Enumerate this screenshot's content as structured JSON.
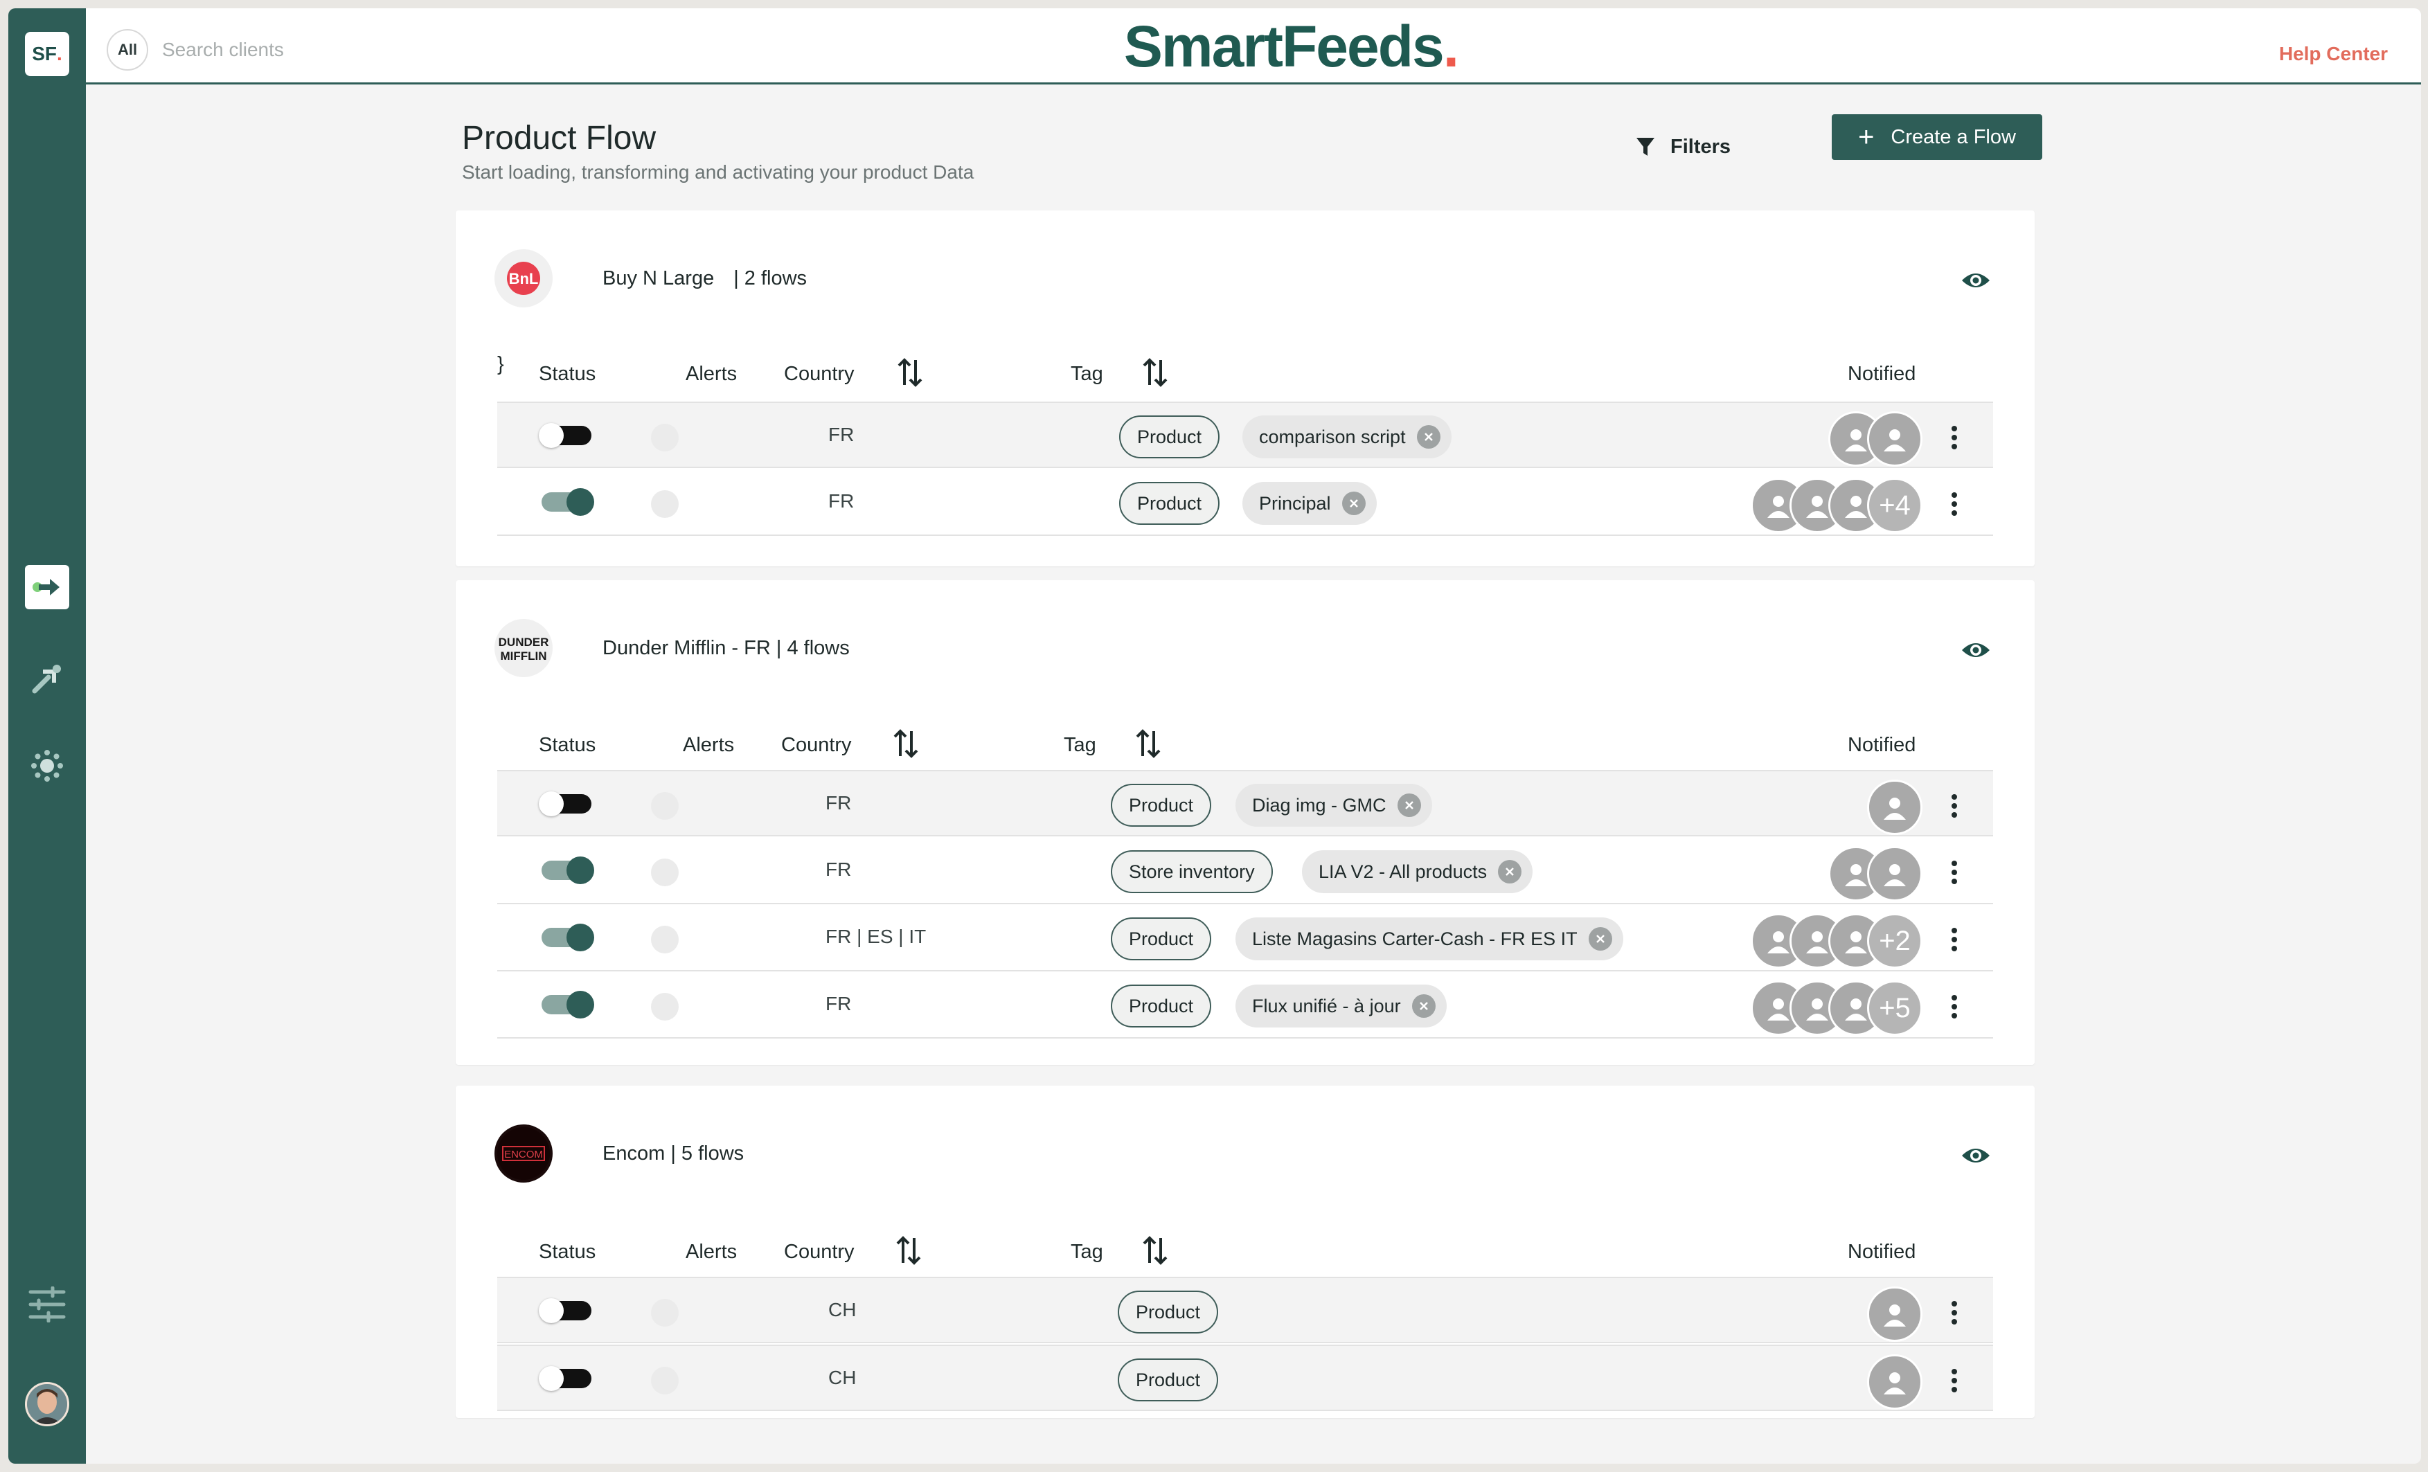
{
  "brand": {
    "name": "SmartFeeds",
    "dot": ".",
    "sidebar_logo": "SF",
    "sidebar_logo_dot": "."
  },
  "topbar": {
    "all_label": "All",
    "search_placeholder": "Search clients",
    "help_label": "Help Center"
  },
  "page": {
    "title": "Product Flow",
    "subtitle": "Start loading, transforming and activating your product Data"
  },
  "actions": {
    "filters_label": "Filters",
    "create_label": "Create a Flow"
  },
  "columns": {
    "status": "Status",
    "alerts": "Alerts",
    "country": "Country",
    "tag": "Tag",
    "notified": "Notified"
  },
  "colors": {
    "primary": "#2e5d57",
    "accent": "#ee5a4c",
    "help": "#e26c5c"
  },
  "sidebar": {
    "items": [
      {
        "icon": "flow-arrow-icon",
        "active": true
      },
      {
        "icon": "rocket-icon",
        "active": false
      },
      {
        "icon": "gear-icon",
        "active": false
      },
      {
        "icon": "sliders-icon",
        "active": false
      }
    ]
  },
  "clients": [
    {
      "name": "Buy N Large",
      "flows": "| 2 flows",
      "logo_text": "BnL",
      "rows": [
        {
          "status": "off",
          "country": "FR",
          "tag": "Product",
          "label": "comparison script",
          "notified": 2,
          "extra": ""
        },
        {
          "status": "on",
          "country": "FR",
          "tag": "Product",
          "label": "Principal",
          "notified": 3,
          "extra": "+4"
        }
      ]
    },
    {
      "name": "Dunder Mifflin - FR",
      "flows": "| 4 flows",
      "logo_text": "DUNDER MIFFLIN",
      "rows": [
        {
          "status": "off",
          "country": "FR",
          "tag": "Product",
          "label": "Diag img - GMC",
          "notified": 1,
          "extra": ""
        },
        {
          "status": "on",
          "country": "FR",
          "tag": "Store inventory",
          "label": "LIA V2 - All products",
          "notified": 2,
          "extra": ""
        },
        {
          "status": "on",
          "country": "FR | ES | IT",
          "tag": "Product",
          "label": "Liste Magasins Carter-Cash - FR ES IT",
          "notified": 3,
          "extra": "+2"
        },
        {
          "status": "on",
          "country": "FR",
          "tag": "Product",
          "label": "Flux unifié - à jour",
          "notified": 3,
          "extra": "+5"
        }
      ]
    },
    {
      "name": "Encom",
      "flows": "| 5 flows",
      "logo_text": "ENCOM",
      "rows": [
        {
          "status": "off",
          "country": "CH",
          "tag": "Product",
          "label": "",
          "notified": 1,
          "extra": ""
        },
        {
          "status": "off",
          "country": "CH",
          "tag": "Product",
          "label": "",
          "notified": 1,
          "extra": ""
        }
      ]
    }
  ]
}
